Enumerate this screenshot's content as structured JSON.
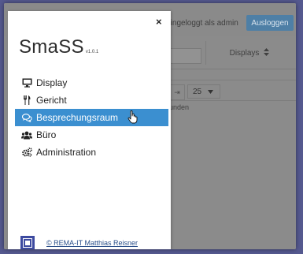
{
  "background_app": {
    "login_text": "Eingeloggt als admin",
    "logout_label": "Ausloggen",
    "column_header": "Displays",
    "sort_icon": "sort-icon",
    "pager_last": "⇥",
    "page_size": "25",
    "table_text": "unden"
  },
  "sidebar": {
    "close_label": "×",
    "brand_name": "SmaSS",
    "brand_version": "v1.0.1",
    "items": [
      {
        "label": "Display",
        "icon": "monitor-icon"
      },
      {
        "label": "Gericht",
        "icon": "fork-knife-icon"
      },
      {
        "label": "Besprechungsraum",
        "icon": "chat-icon",
        "active": true
      },
      {
        "label": "Büro",
        "icon": "users-icon"
      },
      {
        "label": "Administration",
        "icon": "cogs-icon"
      }
    ],
    "footer_text": "© REMA-IT Matthias Reisner"
  },
  "colors": {
    "active_item": "#3b8fd0",
    "logout_button": "#4e7fa6",
    "overlay": "#8b8b8b",
    "footer_logo": "#3d4aa0"
  }
}
